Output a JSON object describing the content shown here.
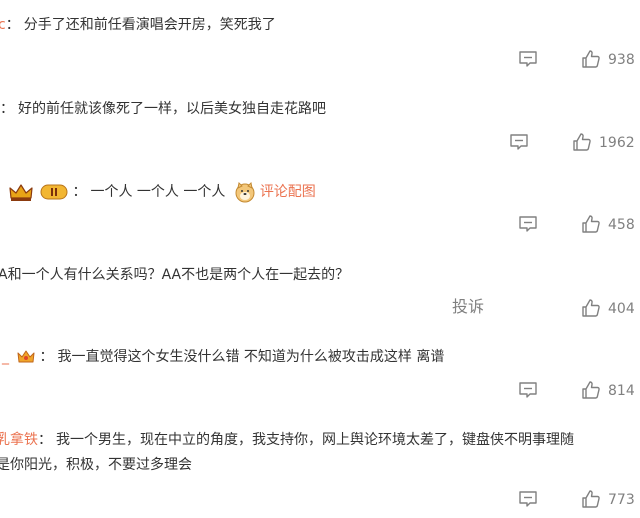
{
  "comments": [
    {
      "user": "c",
      "text": "分手了还和前任看演唱会开房，笑死我了",
      "likes": "938"
    },
    {
      "user": "",
      "text": "好的前任就该像死了一样，以后美女独自走花路吧",
      "likes": "1962"
    },
    {
      "user": "",
      "text": "一个人 一个人 一个人",
      "pic_label": "评论配图",
      "likes": "458"
    },
    {
      "user": "",
      "text": "A和一个人有什么关系吗？AA不也是两个人在一起去的？",
      "report_label": "投诉",
      "likes": "404"
    },
    {
      "user": "_",
      "text": "我一直觉得这个女生没什么错 不知道为什么被攻击成这样 离谱",
      "likes": "814"
    },
    {
      "user": "乳拿铁",
      "text": "我一个男生，现在中立的角度，我支持你，网上舆论环境太差了，键盘侠不明事理随",
      "text2": "是你阳光，积极，不要过多理会",
      "likes": "773"
    }
  ],
  "colors": {
    "username": "#eb7350",
    "text": "#333333",
    "meta": "#808080",
    "crown": "#e8a317"
  },
  "icons": {
    "reply": "comment-bubble-icon",
    "like": "thumbs-up-icon"
  }
}
